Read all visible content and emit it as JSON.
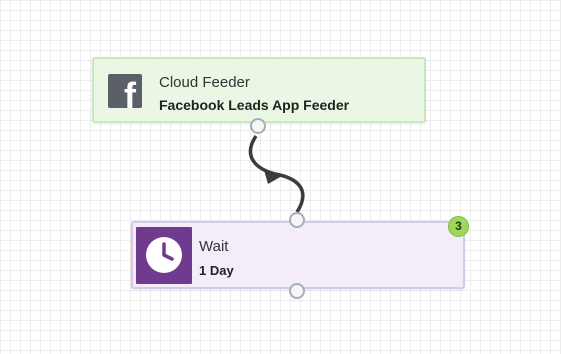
{
  "nodes": {
    "cloud_feeder": {
      "title": "Cloud Feeder",
      "subtitle": "Facebook Leads App Feeder",
      "icon": "facebook-icon",
      "icon_glyph": "f"
    },
    "wait": {
      "title": "Wait",
      "subtitle": "1 Day",
      "icon": "clock-icon",
      "badge": "3"
    }
  },
  "colors": {
    "cloud_bg": "#e9f7e4",
    "wait_bg": "#f5ecfa",
    "wait_icon_bg": "#6e3b8f",
    "badge_bg": "#9ed85a",
    "connector": "#3a3d40"
  }
}
